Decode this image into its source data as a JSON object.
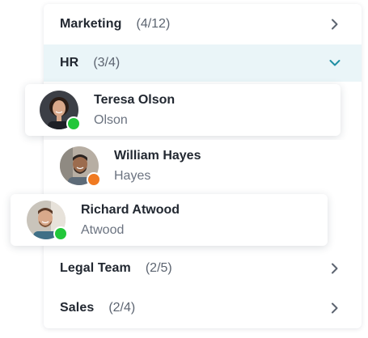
{
  "groups": [
    {
      "name": "Marketing",
      "count": "(4/12)",
      "expanded": false
    },
    {
      "name": "HR",
      "count": "(3/4)",
      "expanded": true
    },
    {
      "name": "Legal Team",
      "count": "(2/5)",
      "expanded": false
    },
    {
      "name": "Sales",
      "count": "(2/4)",
      "expanded": false
    }
  ],
  "members": [
    {
      "name": "Teresa Olson",
      "subtitle": "Olson",
      "status": "online",
      "status_color": "#22c73a"
    },
    {
      "name": "William Hayes",
      "subtitle": "Hayes",
      "status": "away",
      "status_color": "#f07a22"
    },
    {
      "name": "Richard Atwood",
      "subtitle": "Atwood",
      "status": "online",
      "status_color": "#22c73a"
    }
  ],
  "colors": {
    "expanded_bg": "#eaf5f8",
    "accent": "#1f8fa3",
    "chevron": "#5c6470"
  },
  "icons": {
    "collapsed": "chevron-right-icon",
    "expanded": "chevron-down-icon"
  }
}
